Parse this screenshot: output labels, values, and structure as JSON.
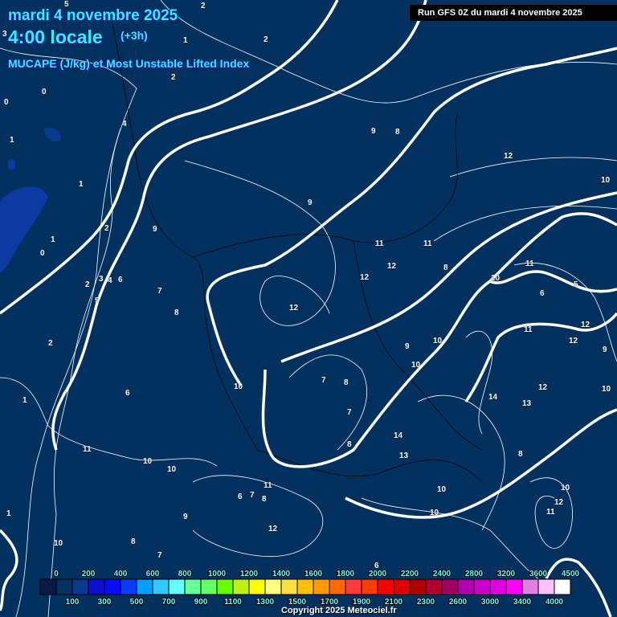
{
  "header": {
    "date": "mardi 4 novembre 2025",
    "time": "4:00 locale",
    "offset": "(+3h)",
    "parameter": "MUCAPE (J/kg) et Most Unstable Lifted Index",
    "run": "Run GFS 0Z du mardi 4 novembre 2025"
  },
  "map": {
    "labels": [
      "5",
      "2",
      "3",
      "1",
      "2",
      "2",
      "0",
      "0",
      "4",
      "1",
      "9",
      "8",
      "12",
      "1",
      "9",
      "10",
      "2",
      "1",
      "9",
      "0",
      "11",
      "11",
      "12",
      "12",
      "8",
      "11",
      "10",
      "2",
      "3",
      "4",
      "6",
      "7",
      "8",
      "12",
      "5",
      "6",
      "10",
      "9",
      "10",
      "7",
      "8",
      "7",
      "8",
      "14",
      "14",
      "13",
      "12",
      "10",
      "11",
      "11",
      "13",
      "8",
      "10",
      "10",
      "12",
      "10",
      "6",
      "7",
      "8",
      "12",
      "9",
      "8",
      "7",
      "6",
      "1",
      "10",
      "11",
      "10",
      "2",
      "1",
      "5",
      "9",
      "10",
      "12",
      "12",
      "11",
      "6",
      "10"
    ]
  },
  "legend": {
    "colors": [
      "#0b1a45",
      "#06305f",
      "#0a3a90",
      "#0a10cc",
      "#0a0aff",
      "#0a3cff",
      "#00a0ff",
      "#30c8ff",
      "#66ffff",
      "#66ff99",
      "#66ff66",
      "#66ff00",
      "#c0f010",
      "#ffff00",
      "#ffff80",
      "#ffe040",
      "#ffc000",
      "#ff9a00",
      "#ff6a00",
      "#ff3a3a",
      "#ff3c00",
      "#ff0000",
      "#e00000",
      "#b00000",
      "#b00030",
      "#a00060",
      "#b000b0",
      "#cc00cc",
      "#e000e0",
      "#ff00ff",
      "#e080e0",
      "#ffc0ff",
      "#ffffff"
    ],
    "top_labels": [
      "0",
      "200",
      "400",
      "600",
      "800",
      "1000",
      "1200",
      "1400",
      "1600",
      "1800",
      "2000",
      "2200",
      "2400",
      "2800",
      "3200",
      "3600",
      "4500"
    ],
    "bottom_labels": [
      "100",
      "300",
      "500",
      "700",
      "900",
      "1100",
      "1300",
      "1500",
      "1700",
      "1900",
      "2100",
      "2300",
      "2600",
      "3000",
      "3400",
      "4000"
    ]
  },
  "footer": {
    "copyright": "Copyright 2025 Meteociel.fr"
  }
}
